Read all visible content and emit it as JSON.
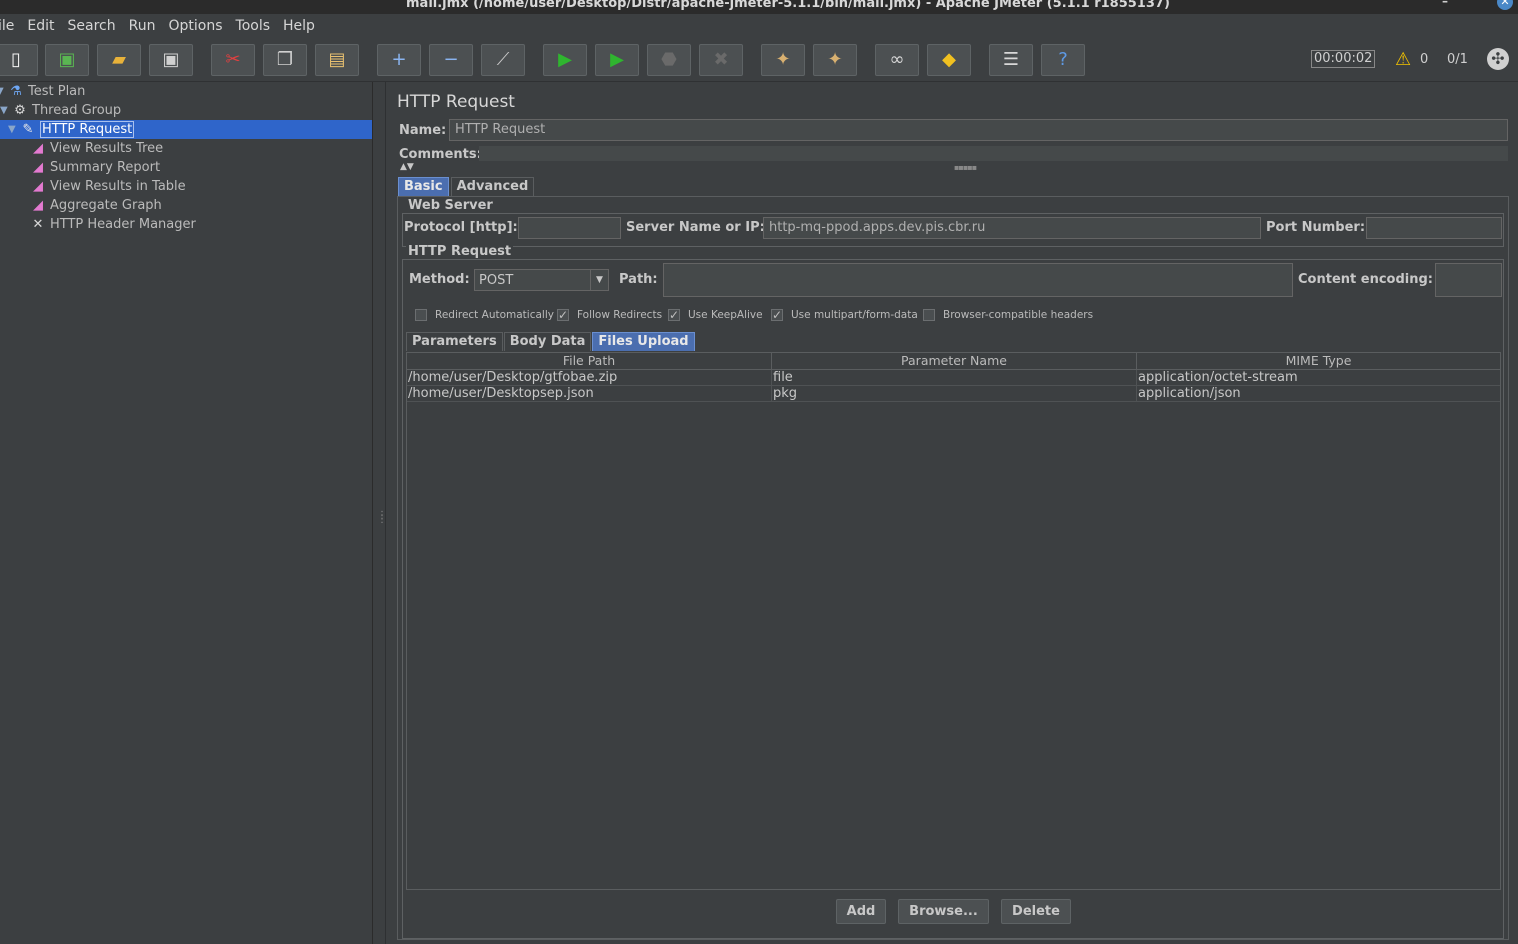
{
  "window": {
    "title": "mail.jmx (/home/user/Desktop/Distr/apache-jmeter-5.1.1/bin/mail.jmx) - Apache JMeter (5.1.1 r1855137)",
    "minimize": "–",
    "maximize": "˄",
    "close": "✕"
  },
  "menu": [
    "ile",
    "Edit",
    "Search",
    "Run",
    "Options",
    "Tools",
    "Help"
  ],
  "status": {
    "timer": "00:00:02",
    "warnings": "0",
    "threads": "0/1"
  },
  "tree": [
    {
      "label": "Test Plan",
      "icon": "flask-icon"
    },
    {
      "label": "Thread Group",
      "icon": "gear-icon"
    },
    {
      "label": "HTTP Request",
      "icon": "pipette-icon",
      "selected": true
    },
    {
      "label": "View Results Tree",
      "icon": "graph-icon"
    },
    {
      "label": "Summary Report",
      "icon": "graph-icon"
    },
    {
      "label": "View Results in Table",
      "icon": "graph-icon"
    },
    {
      "label": "Aggregate Graph",
      "icon": "graph-icon"
    },
    {
      "label": "HTTP Header Manager",
      "icon": "tools-icon"
    }
  ],
  "panel": {
    "title": "HTTP Request",
    "name_label": "Name:",
    "name_value": "HTTP Request",
    "comments_label": "Comments:",
    "tabs": [
      "Basic",
      "Advanced"
    ],
    "web_server": {
      "title": "Web Server",
      "protocol_label": "Protocol [http]:",
      "protocol_value": "",
      "server_label": "Server Name or IP:",
      "server_value": "http-mq-ppod.apps.dev.pis.cbr.ru",
      "port_label": "Port Number:",
      "port_value": ""
    },
    "http_request": {
      "title": "HTTP Request",
      "method_label": "Method:",
      "method_value": "POST",
      "path_label": "Path:",
      "path_value": "",
      "encoding_label": "Content encoding:",
      "encoding_value": ""
    },
    "checkboxes": [
      {
        "label": "Redirect Automatically",
        "checked": false
      },
      {
        "label": "Follow Redirects",
        "checked": true
      },
      {
        "label": "Use KeepAlive",
        "checked": true
      },
      {
        "label": "Use multipart/form-data",
        "checked": true
      },
      {
        "label": "Browser-compatible headers",
        "checked": false
      }
    ],
    "subtabs": [
      "Parameters",
      "Body Data",
      "Files Upload"
    ],
    "table": {
      "headers": [
        "File Path",
        "Parameter Name",
        "MIME Type"
      ],
      "rows": [
        [
          "/home/user/Desktop/gtfobae.zip",
          "file",
          "application/octet-stream"
        ],
        [
          "/home/user/Desktopsep.json",
          "pkg",
          "application/json"
        ]
      ]
    },
    "buttons": {
      "add": "Add",
      "browse": "Browse...",
      "delete": "Delete"
    }
  }
}
